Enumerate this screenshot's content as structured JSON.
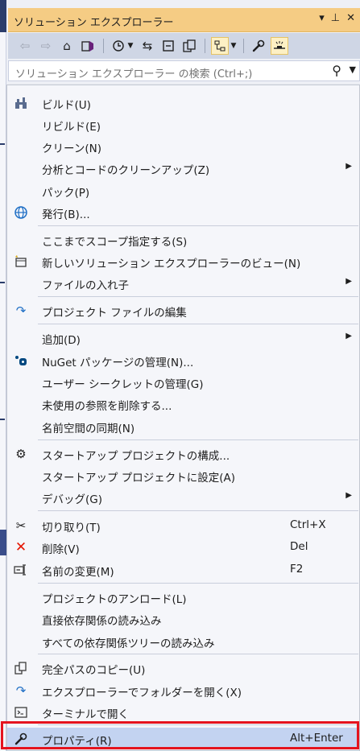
{
  "panel": {
    "title": "ソリューション エクスプローラー",
    "title_buttons": [
      "▾",
      "⊥",
      "✕"
    ],
    "search_placeholder": "ソリューション エクスプローラー の検索 (Ctrl+;)"
  },
  "menu": {
    "items": [
      {
        "label": "ビルド(U)",
        "icon": "build-icon"
      },
      {
        "label": "リビルド(E)"
      },
      {
        "label": "クリーン(N)"
      },
      {
        "label": "分析とコードのクリーンアップ(Z)",
        "submenu": true
      },
      {
        "label": "パック(P)"
      },
      {
        "label": "発行(B)...",
        "icon": "publish-globe-icon"
      },
      {
        "label": "ここまでスコープ指定する(S)"
      },
      {
        "label": "新しいソリューション エクスプローラーのビュー(N)",
        "icon": "new-view-icon"
      },
      {
        "label": "ファイルの入れ子",
        "submenu": true
      },
      {
        "label": "プロジェクト ファイルの編集",
        "icon": "edit-project-icon"
      },
      {
        "label": "追加(D)",
        "submenu": true
      },
      {
        "label": "NuGet パッケージの管理(N)...",
        "icon": "nuget-icon"
      },
      {
        "label": "ユーザー シークレットの管理(G)"
      },
      {
        "label": "未使用の参照を削除する..."
      },
      {
        "label": "名前空間の同期(N)"
      },
      {
        "label": "スタートアップ プロジェクトの構成...",
        "icon": "gear-icon"
      },
      {
        "label": "スタートアップ プロジェクトに設定(A)"
      },
      {
        "label": "デバッグ(G)",
        "submenu": true
      },
      {
        "label": "切り取り(T)",
        "icon": "scissors-icon",
        "shortcut": "Ctrl+X"
      },
      {
        "label": "削除(V)",
        "icon": "delete-x-icon",
        "shortcut": "Del"
      },
      {
        "label": "名前の変更(M)",
        "icon": "rename-icon",
        "shortcut": "F2"
      },
      {
        "label": "プロジェクトのアンロード(L)"
      },
      {
        "label": "直接依存関係の読み込み"
      },
      {
        "label": "すべての依存関係ツリーの読み込み"
      },
      {
        "label": "完全パスのコピー(U)",
        "icon": "copy-path-icon"
      },
      {
        "label": "エクスプローラーでフォルダーを開く(X)",
        "icon": "open-folder-icon"
      },
      {
        "label": "ターミナルで開く",
        "icon": "terminal-icon"
      },
      {
        "label": "プロパティ(R)",
        "icon": "wrench-icon",
        "shortcut": "Alt+Enter",
        "highlighted": true
      }
    ]
  },
  "colors": {
    "title_bar": "#f5cc84",
    "toolbar": "#cfd6e5",
    "menu_bg": "#f5f6fa",
    "highlight": "#c3d3f1",
    "annotation_box": "#e5141e"
  }
}
